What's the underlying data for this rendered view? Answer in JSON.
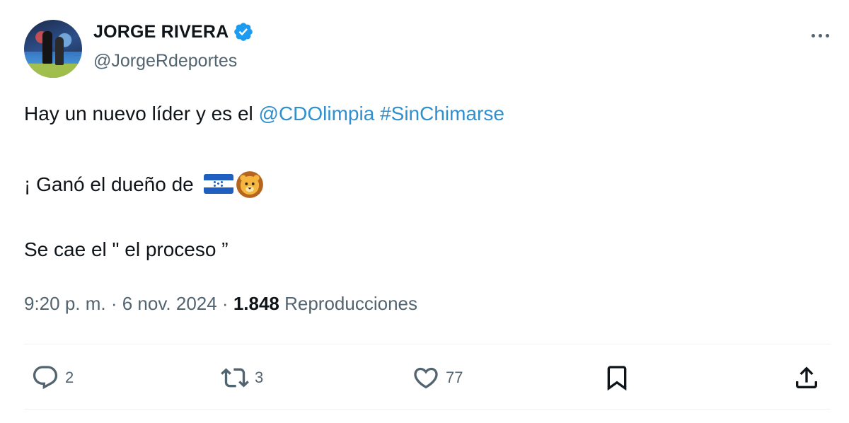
{
  "author": {
    "display_name": "JORGE RIVERA",
    "handle": "@JorgeRdeportes",
    "verified": true
  },
  "tweet": {
    "line1_text": "Hay un nuevo líder y es el ",
    "mention": "@CDOlimpia",
    "hashtag": "#SinChimarse",
    "line2_text": "¡ Ganó el dueño de ",
    "line2_emojis": [
      "honduras-flag",
      "lion-face"
    ],
    "line3_text": "Se cae el \" el proceso ”"
  },
  "meta": {
    "time": "9:20 p. m.",
    "sep1": " · ",
    "date": "6 nov. 2024",
    "sep2": " · ",
    "views_count": "1.848",
    "views_label": " Reproducciones"
  },
  "actions": {
    "reply_count": "2",
    "retweet_count": "3",
    "like_count": "77"
  },
  "colors": {
    "link": "#2f8fcf",
    "verified": "#1d9bf0",
    "muted": "#536471"
  }
}
